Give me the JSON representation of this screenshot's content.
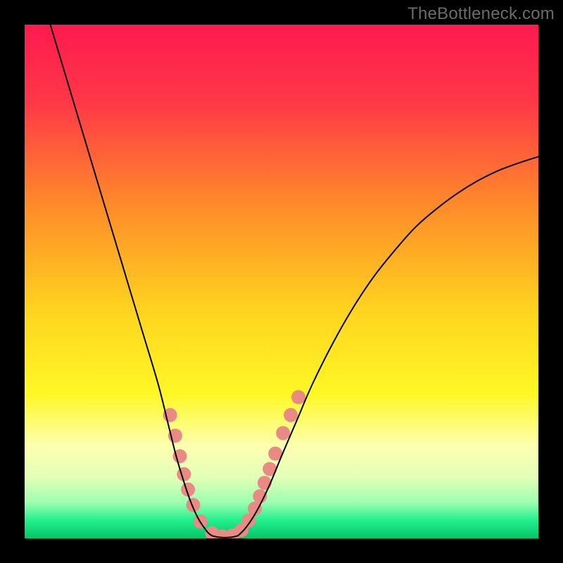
{
  "watermark": "TheBottleneck.com",
  "chart_data": {
    "type": "line",
    "title": "",
    "xlabel": "",
    "ylabel": "",
    "xlim": [
      0,
      100
    ],
    "ylim": [
      0,
      100
    ],
    "grid": false,
    "legend": false,
    "gradient_stops": [
      {
        "offset": 0.0,
        "color": "#ff1a4f"
      },
      {
        "offset": 0.15,
        "color": "#ff3747"
      },
      {
        "offset": 0.35,
        "color": "#ff8a2a"
      },
      {
        "offset": 0.55,
        "color": "#ffd21f"
      },
      {
        "offset": 0.72,
        "color": "#fff826"
      },
      {
        "offset": 0.82,
        "color": "#fdffb0"
      },
      {
        "offset": 0.88,
        "color": "#e4ffb8"
      },
      {
        "offset": 0.93,
        "color": "#9dffb0"
      },
      {
        "offset": 0.965,
        "color": "#22ef8d"
      },
      {
        "offset": 1.0,
        "color": "#07c567"
      }
    ],
    "series": [
      {
        "name": "left-branch",
        "color": "#000000",
        "width": 2,
        "x": [
          5.0,
          8.0,
          11.0,
          14.0,
          17.0,
          20.0,
          23.0,
          26.0,
          28.0,
          29.5,
          31.0,
          32.0,
          33.0,
          34.0,
          35.0,
          35.8,
          36.5
        ],
        "y": [
          100.0,
          90.0,
          80.0,
          70.0,
          60.0,
          50.0,
          40.0,
          30.0,
          22.0,
          16.0,
          11.0,
          8.0,
          5.5,
          3.5,
          2.0,
          1.0,
          0.5
        ]
      },
      {
        "name": "valley-floor",
        "color": "#000000",
        "width": 2,
        "x": [
          36.5,
          38.0,
          40.0,
          41.5
        ],
        "y": [
          0.5,
          0.2,
          0.2,
          0.5
        ]
      },
      {
        "name": "right-branch",
        "color": "#000000",
        "width": 2,
        "x": [
          41.5,
          43.0,
          45.0,
          47.5,
          50.0,
          53.0,
          56.0,
          60.0,
          64.0,
          68.0,
          72.0,
          76.0,
          80.0,
          84.0,
          88.0,
          92.0,
          96.0,
          100.0
        ],
        "y": [
          0.5,
          2.0,
          5.0,
          10.0,
          16.0,
          23.0,
          30.0,
          38.0,
          45.0,
          51.0,
          56.0,
          60.5,
          64.0,
          67.0,
          69.5,
          71.5,
          73.0,
          74.3
        ]
      }
    ],
    "markers": {
      "name": "salmon-markers",
      "color": "#e98b84",
      "radius": 10,
      "points": [
        {
          "x": 28.3,
          "y": 24.0
        },
        {
          "x": 29.3,
          "y": 20.0
        },
        {
          "x": 30.2,
          "y": 16.0
        },
        {
          "x": 31.0,
          "y": 12.5
        },
        {
          "x": 31.8,
          "y": 9.5
        },
        {
          "x": 32.8,
          "y": 6.5
        },
        {
          "x": 34.2,
          "y": 3.3
        },
        {
          "x": 36.5,
          "y": 1.0
        },
        {
          "x": 38.5,
          "y": 0.4
        },
        {
          "x": 40.5,
          "y": 0.6
        },
        {
          "x": 42.2,
          "y": 1.6
        },
        {
          "x": 43.6,
          "y": 3.5
        },
        {
          "x": 44.8,
          "y": 5.8
        },
        {
          "x": 45.8,
          "y": 8.2
        },
        {
          "x": 46.7,
          "y": 10.8
        },
        {
          "x": 47.7,
          "y": 13.5
        },
        {
          "x": 48.8,
          "y": 16.5
        },
        {
          "x": 50.3,
          "y": 20.5
        },
        {
          "x": 51.8,
          "y": 24.0
        },
        {
          "x": 53.3,
          "y": 27.5
        }
      ]
    }
  }
}
